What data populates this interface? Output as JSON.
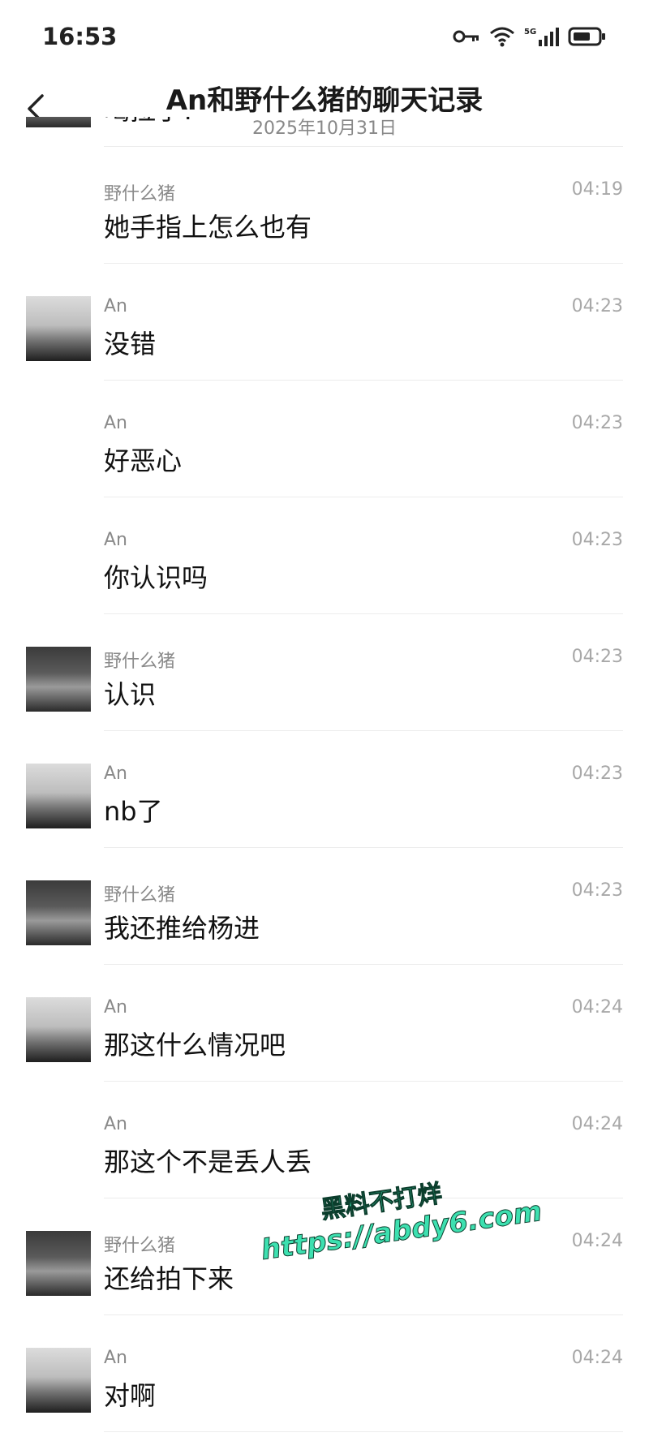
{
  "status_bar": {
    "time": "16:53",
    "network": "5G"
  },
  "header": {
    "title": "An和野什么猪的聊天记录",
    "date": "2025年10月31日"
  },
  "messages": [
    {
      "sender": "",
      "time": "",
      "text": "喝拉了?",
      "avatar": "zhu"
    },
    {
      "sender": "野什么猪",
      "time": "04:19",
      "text": "她手指上怎么也有",
      "avatar": ""
    },
    {
      "sender": "An",
      "time": "04:23",
      "text": "没错",
      "avatar": "an"
    },
    {
      "sender": "An",
      "time": "04:23",
      "text": "好恶心",
      "avatar": ""
    },
    {
      "sender": "An",
      "time": "04:23",
      "text": "你认识吗",
      "avatar": ""
    },
    {
      "sender": "野什么猪",
      "time": "04:23",
      "text": "认识",
      "avatar": "zhu"
    },
    {
      "sender": "An",
      "time": "04:23",
      "text": "nb了",
      "avatar": "an"
    },
    {
      "sender": "野什么猪",
      "time": "04:23",
      "text": "我还推给杨进",
      "avatar": "zhu"
    },
    {
      "sender": "An",
      "time": "04:24",
      "text": "那这什么情况吧",
      "avatar": "an"
    },
    {
      "sender": "An",
      "time": "04:24",
      "text": "那这个不是丢人丢",
      "avatar": ""
    },
    {
      "sender": "野什么猪",
      "time": "04:24",
      "text": "还给拍下来",
      "avatar": "zhu"
    },
    {
      "sender": "An",
      "time": "04:24",
      "text": "对啊",
      "avatar": "an"
    }
  ],
  "watermark": {
    "line1": "黑料不打烊",
    "line2": "https://abdy6.com"
  }
}
